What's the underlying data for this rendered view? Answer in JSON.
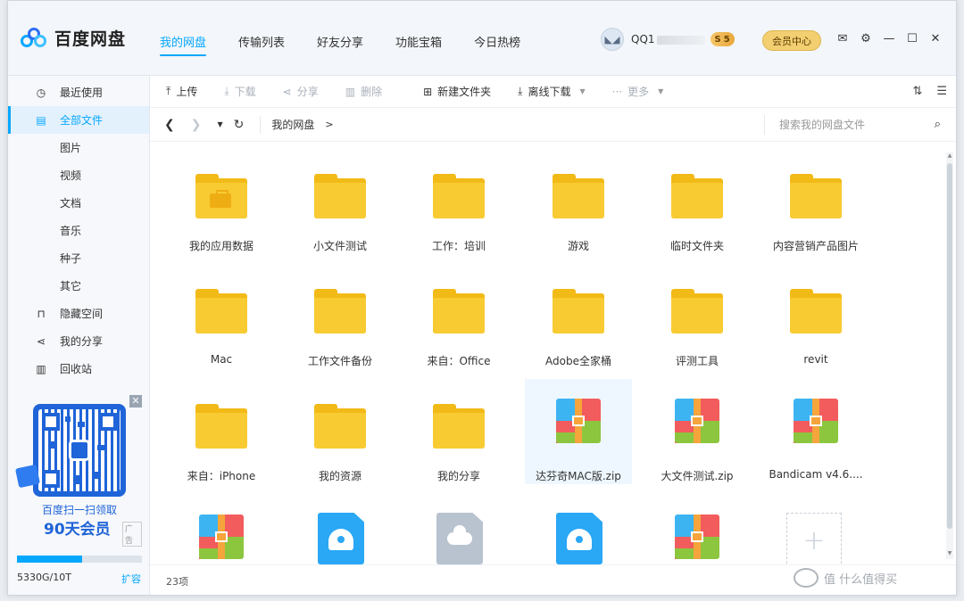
{
  "app": {
    "name": "百度网盘"
  },
  "nav": {
    "tabs": [
      "我的网盘",
      "传输列表",
      "好友分享",
      "功能宝箱",
      "今日热榜"
    ],
    "active_index": 0
  },
  "user": {
    "name": "QQ1",
    "level_badge": "5",
    "vip_center": "会员中心"
  },
  "sidebar": {
    "items": [
      {
        "label": "最近使用",
        "icon": "clock-icon",
        "glyph": "◷"
      },
      {
        "label": "全部文件",
        "icon": "file-icon",
        "glyph": "▤"
      },
      {
        "label": "图片"
      },
      {
        "label": "视频"
      },
      {
        "label": "文档"
      },
      {
        "label": "音乐"
      },
      {
        "label": "种子"
      },
      {
        "label": "其它"
      },
      {
        "label": "隐藏空间",
        "icon": "lock-icon",
        "glyph": "⊓"
      },
      {
        "label": "我的分享",
        "icon": "share-icon",
        "glyph": "⋖"
      },
      {
        "label": "回收站",
        "icon": "trash-icon",
        "glyph": "▥"
      }
    ],
    "promo": {
      "line1": "百度扫一扫领取",
      "line2": "90天会员",
      "ad": "广告"
    },
    "storage": {
      "text": "5330G/10T",
      "expand": "扩容",
      "used_fraction": 0.52
    }
  },
  "toolbar": {
    "upload": "上传",
    "download": "下载",
    "share": "分享",
    "delete": "删除",
    "new_folder": "新建文件夹",
    "offline_download": "离线下载",
    "more": "更多"
  },
  "addressbar": {
    "crumb": "我的网盘",
    "search_placeholder": "搜索我的网盘文件"
  },
  "files": [
    {
      "name": "我的应用数据",
      "type": "folder-app"
    },
    {
      "name": "小文件测试",
      "type": "folder"
    },
    {
      "name": "工作：培训",
      "type": "folder"
    },
    {
      "name": "游戏",
      "type": "folder"
    },
    {
      "name": "临时文件夹",
      "type": "folder"
    },
    {
      "name": "内容营销产品图片",
      "type": "folder"
    },
    {
      "name": "Mac",
      "type": "folder"
    },
    {
      "name": "工作文件备份",
      "type": "folder"
    },
    {
      "name": "来自：Office",
      "type": "folder"
    },
    {
      "name": "Adobe全家桶",
      "type": "folder"
    },
    {
      "name": "评测工具",
      "type": "folder"
    },
    {
      "name": "revit",
      "type": "folder"
    },
    {
      "name": "来自：iPhone",
      "type": "folder"
    },
    {
      "name": "我的资源",
      "type": "folder"
    },
    {
      "name": "我的分享",
      "type": "folder"
    },
    {
      "name": "达芬奇MAC版.zip",
      "type": "zip",
      "selected": true
    },
    {
      "name": "大文件测试.zip",
      "type": "zip"
    },
    {
      "name": "Bandicam v4.6....",
      "type": "zip"
    },
    {
      "name": "",
      "type": "zip"
    },
    {
      "name": "",
      "type": "disk"
    },
    {
      "name": "",
      "type": "cloud"
    },
    {
      "name": "",
      "type": "disk"
    },
    {
      "name": "",
      "type": "zip"
    },
    {
      "name": "",
      "type": "add"
    }
  ],
  "status": {
    "count": "23项"
  },
  "watermark": "值 什么值得买",
  "colors": {
    "accent": "#06a7ff",
    "folder": "#f8cb33",
    "vip": "#f3cf72"
  }
}
